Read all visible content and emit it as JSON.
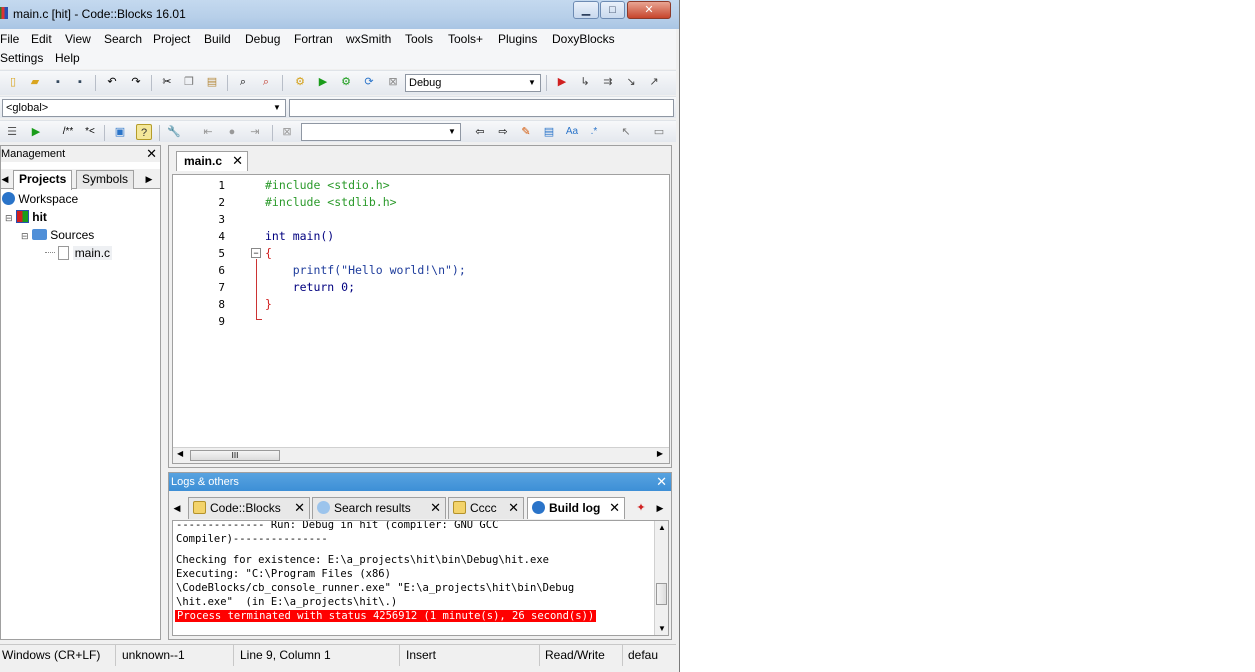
{
  "window": {
    "title": "main.c [hit] - Code::Blocks 16.01"
  },
  "menu": [
    "File",
    "Edit",
    "View",
    "Search",
    "Project",
    "Build",
    "Debug",
    "Fortran",
    "wxSmith",
    "Tools",
    "Tools+",
    "Plugins",
    "DoxyBlocks",
    "Settings",
    "Help"
  ],
  "toolbar": {
    "build_target": "Debug",
    "scope": "<global>",
    "search_text": ""
  },
  "management": {
    "title": "Management",
    "tabs": [
      "Projects",
      "Symbols"
    ],
    "tree": {
      "workspace": "Workspace",
      "project": "hit",
      "folder": "Sources",
      "file": "main.c"
    }
  },
  "editor": {
    "tab": "main.c",
    "lines": [
      {
        "no": "1",
        "code": "#include <stdio.h>"
      },
      {
        "no": "2",
        "code": "#include <stdlib.h>"
      },
      {
        "no": "3",
        "code": ""
      },
      {
        "no": "4",
        "code": "int main()"
      },
      {
        "no": "5",
        "code": "{"
      },
      {
        "no": "6",
        "code": "    printf(\"Hello world!\\n\");"
      },
      {
        "no": "7",
        "code": "    return 0;"
      },
      {
        "no": "8",
        "code": "}"
      },
      {
        "no": "9",
        "code": ""
      }
    ],
    "hscroll_thumb": "III"
  },
  "logs": {
    "title": "Logs & others",
    "tabs": [
      "Code::Blocks",
      "Search results",
      "Cccc",
      "Build log"
    ],
    "lines": [
      "-------------- Run: Debug in hit (compiler: GNU GCC",
      "Compiler)---------------",
      "",
      "Checking for existence: E:\\a_projects\\hit\\bin\\Debug\\hit.exe",
      "Executing: \"C:\\Program Files (x86)",
      "\\CodeBlocks/cb_console_runner.exe\" \"E:\\a_projects\\hit\\bin\\Debug",
      "\\hit.exe\"  (in E:\\a_projects\\hit\\.)"
    ],
    "error_line": "Process terminated with status 4256912 (1 minute(s), 26 second(s))"
  },
  "status": {
    "eol": "Windows (CR+LF)",
    "encoding": "unknown--1",
    "position": "Line 9, Column 1",
    "mode": "Insert",
    "access": "Read/Write",
    "extra": "defau"
  }
}
